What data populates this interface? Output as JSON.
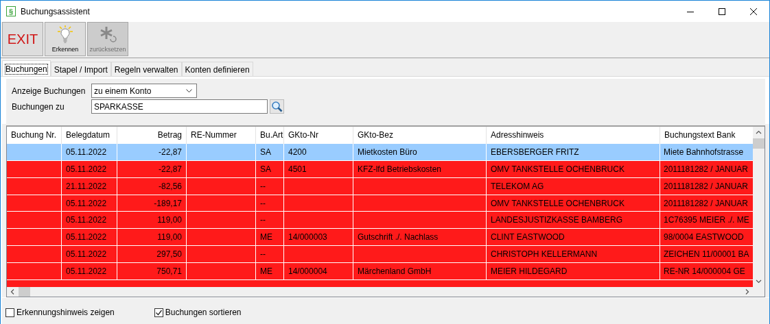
{
  "window": {
    "title": "Buchungsassistent",
    "icon": "§"
  },
  "toolbar": [
    {
      "label": "EXIT",
      "kind": "exit",
      "disabled": false
    },
    {
      "label": "Erkennen",
      "kind": "bulb",
      "disabled": false
    },
    {
      "label": "zurücksetzen",
      "kind": "reset",
      "disabled": true
    }
  ],
  "tabs": [
    {
      "label": "Buchungen",
      "selected": true
    },
    {
      "label": "Stapel / Import",
      "selected": false
    },
    {
      "label": "Regeln verwalten",
      "selected": false
    },
    {
      "label": "Konten definieren",
      "selected": false
    }
  ],
  "filter": {
    "display_label": "Anzeige Buchungen",
    "display_value": "zu einem Konto",
    "account_label": "Buchungen zu",
    "account_value": "SPARKASSE"
  },
  "table": {
    "columns": [
      "Buchung Nr.",
      "Belegdatum",
      "Betrag",
      "RE-Nummer",
      "Bu.Art",
      "GKto-Nr",
      "GKto-Bez",
      "Adresshinweis",
      "Buchungstext Bank"
    ],
    "rows": [
      {
        "selected": true,
        "cells": [
          "",
          "05.11.2022",
          "-22,87",
          "",
          "SA",
          "4200",
          "Mietkosten Büro",
          "EBERSBERGER FRITZ",
          "Miete Bahnhofstrasse"
        ]
      },
      {
        "selected": false,
        "cells": [
          "",
          "05.11.2022",
          "-22,87",
          "",
          "SA",
          "4501",
          "KFZ-lfd Betriebskosten",
          "OMV TANKSTELLE OCHENBRUCK",
          "2011181282 / JANUAR"
        ]
      },
      {
        "selected": false,
        "cells": [
          "",
          "21.11.2022",
          "-82,56",
          "",
          "--",
          "",
          "",
          "TELEKOM AG",
          "2011181282 / JANUAR"
        ]
      },
      {
        "selected": false,
        "cells": [
          "",
          "05.11.2022",
          "-189,17",
          "",
          "--",
          "",
          "",
          "OMV TANKSTELLE OCHENBRUCK",
          "2011181282 / JANUAR"
        ]
      },
      {
        "selected": false,
        "cells": [
          "",
          "05.11.2022",
          "119,00",
          "",
          "--",
          "",
          "",
          "LANDESJUSTIZKASSE BAMBERG",
          "1C76395 MEIER ./. ME"
        ]
      },
      {
        "selected": false,
        "cells": [
          "",
          "05.11.2022",
          "119,00",
          "",
          "ME",
          "14/000003",
          "Gutschrift ./. Nachlass",
          "CLINT EASTWOOD",
          "98/0004 EASTWOOD"
        ]
      },
      {
        "selected": false,
        "cells": [
          "",
          "05.11.2022",
          "297,50",
          "",
          "--",
          "",
          "",
          "CHRISTOPH KELLERMANN",
          "ZEICHEN 11/00001 BA"
        ]
      },
      {
        "selected": false,
        "cells": [
          "",
          "05.11.2022",
          "750,71",
          "",
          "ME",
          "14/000004",
          "Märchenland GmbH",
          "MEIER HILDEGARD",
          "RE-NR 14/000004 GE"
        ]
      }
    ]
  },
  "options": [
    {
      "label": "Erkennungshinweis zeigen",
      "checked": false
    },
    {
      "label": "Buchungen sortieren",
      "checked": true
    }
  ]
}
